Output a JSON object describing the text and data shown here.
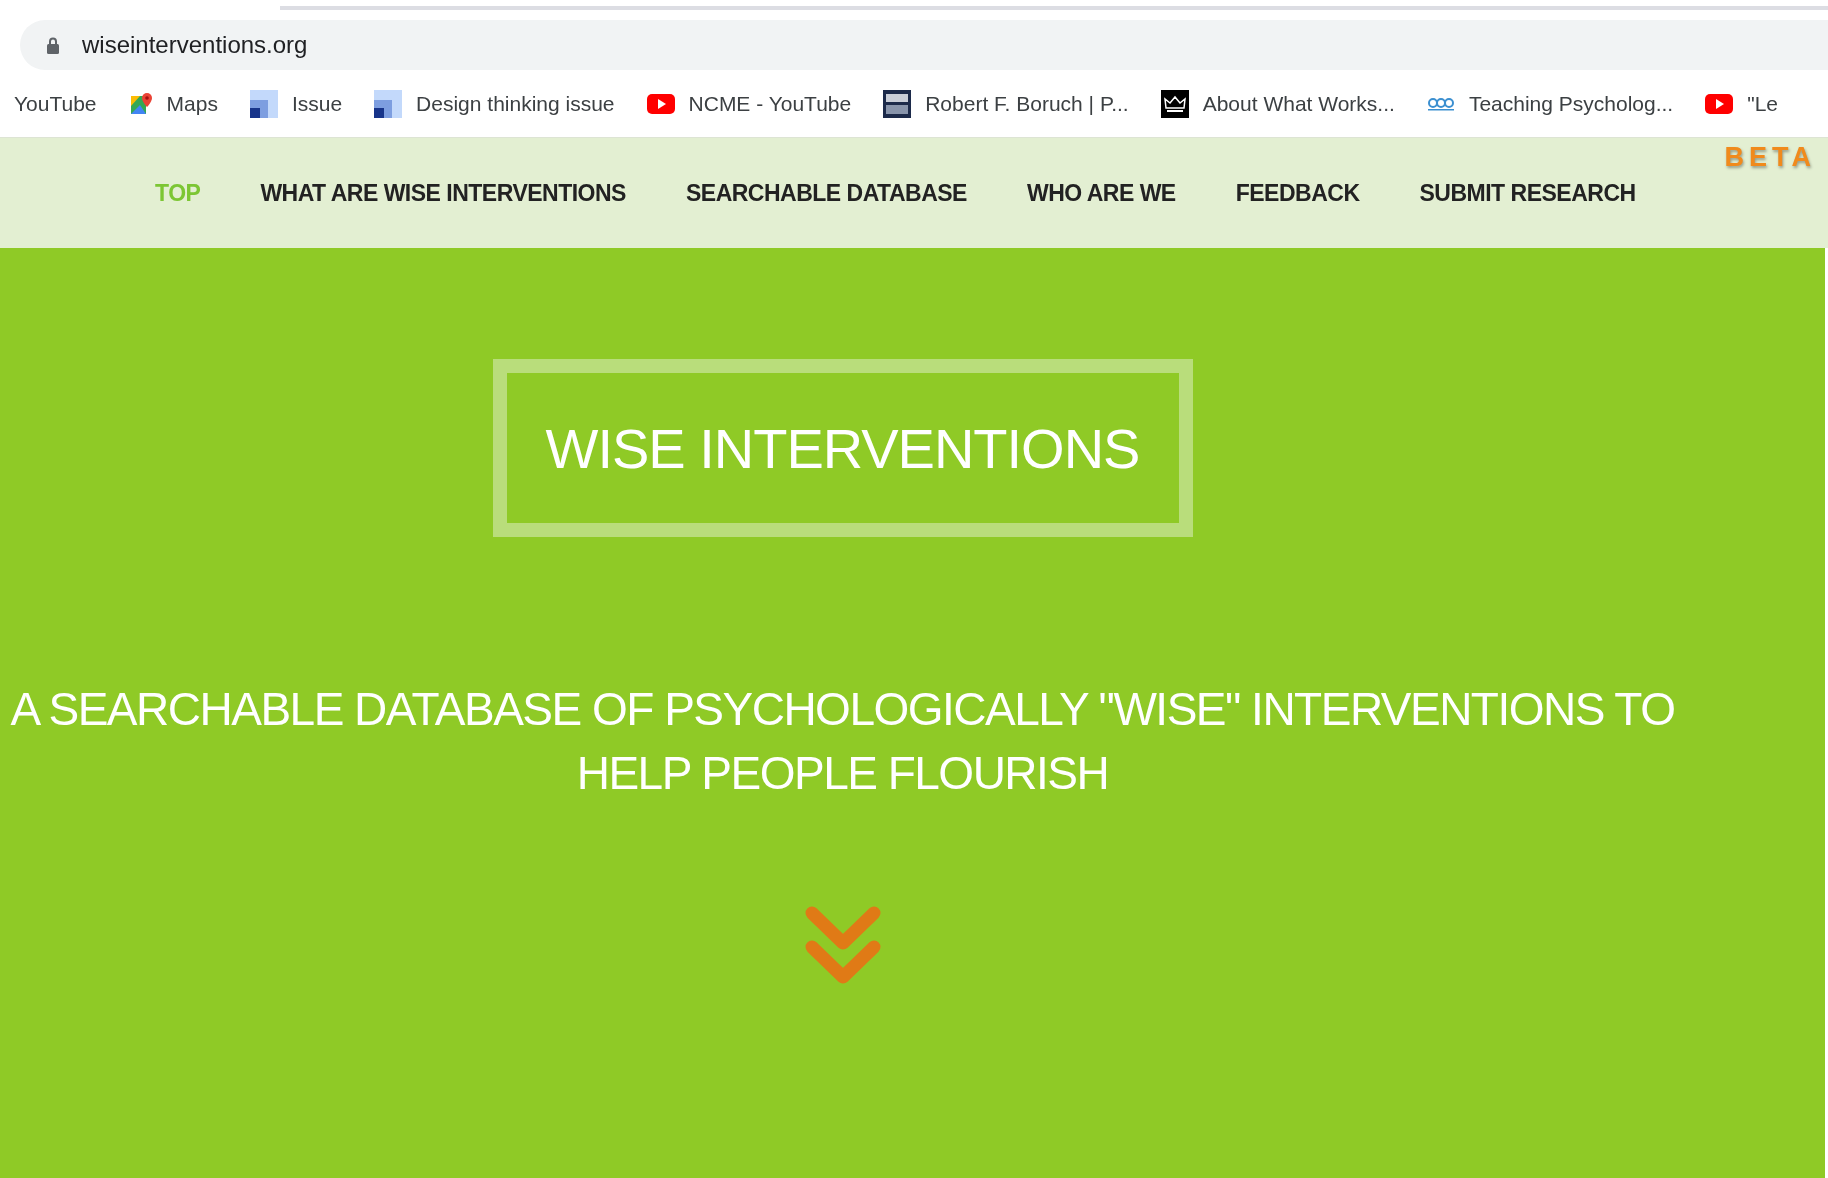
{
  "browser": {
    "url": "wiseinterventions.org",
    "bookmarks": [
      {
        "label": "YouTube"
      },
      {
        "label": "Maps"
      },
      {
        "label": "Issue"
      },
      {
        "label": "Design thinking issue"
      },
      {
        "label": "NCME - YouTube"
      },
      {
        "label": "Robert F. Boruch | P..."
      },
      {
        "label": "About What Works..."
      },
      {
        "label": "Teaching Psycholog..."
      },
      {
        "label": "\"Le"
      }
    ]
  },
  "nav": {
    "items": [
      {
        "label": "TOP",
        "selected": true
      },
      {
        "label": "WHAT ARE WISE INTERVENTIONS",
        "selected": false
      },
      {
        "label": "SEARCHABLE DATABASE",
        "selected": false
      },
      {
        "label": "WHO ARE WE",
        "selected": false
      },
      {
        "label": "FEEDBACK",
        "selected": false
      },
      {
        "label": "SUBMIT RESEARCH",
        "selected": false
      }
    ],
    "badge": "BETA"
  },
  "hero": {
    "title": "WISE INTERVENTIONS",
    "subtitle": "A SEARCHABLE DATABASE OF PSYCHOLOGICALLY \"WISE\" INTERVENTIONS TO HELP PEOPLE FLOURISH"
  }
}
